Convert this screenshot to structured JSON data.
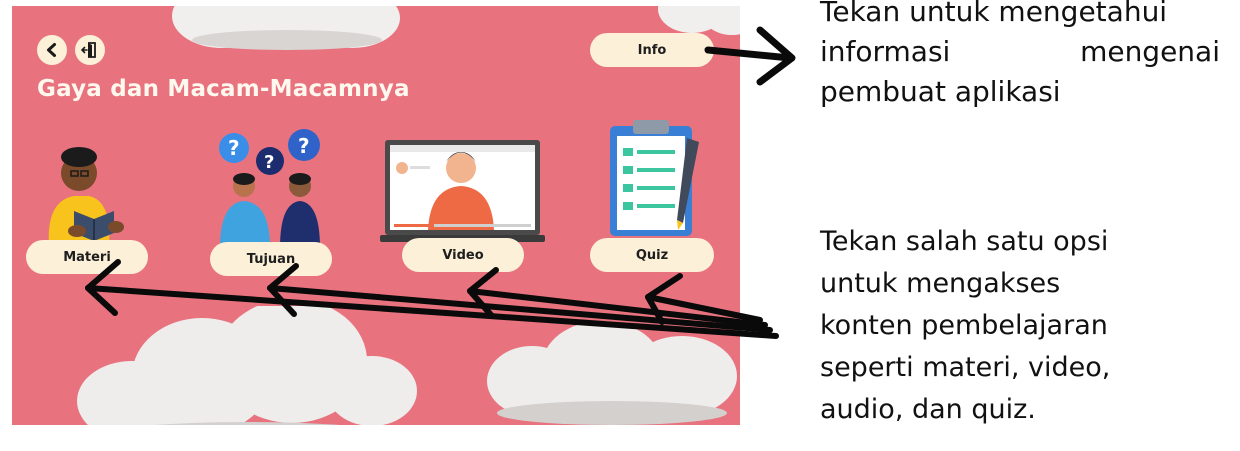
{
  "app": {
    "title": "Gaya dan Macam-Macamnya",
    "back_icon": "chevron-left-icon",
    "exit_icon": "exit-door-icon",
    "info_label": "Info",
    "menu": [
      {
        "label": "Materi",
        "illustration": "reading-student"
      },
      {
        "label": "Tujuan",
        "illustration": "questioning-people"
      },
      {
        "label": "Video",
        "illustration": "video-laptop"
      },
      {
        "label": "Quiz",
        "illustration": "quiz-clipboard"
      }
    ],
    "colors": {
      "background": "#e8737f",
      "button": "#fdf0d9",
      "title": "#fff8ee"
    }
  },
  "annotations": {
    "info_note_lines": [
      "Tekan untuk mengetahui",
      "informasi mengenai",
      "pembuat aplikasi"
    ],
    "info_note_line2_words": [
      "informasi",
      "mengenai"
    ],
    "menu_note_lines": [
      "Tekan salah satu opsi",
      "untuk mengakses",
      "konten pembelajaran",
      "seperti materi, video,",
      "audio, dan quiz."
    ]
  }
}
